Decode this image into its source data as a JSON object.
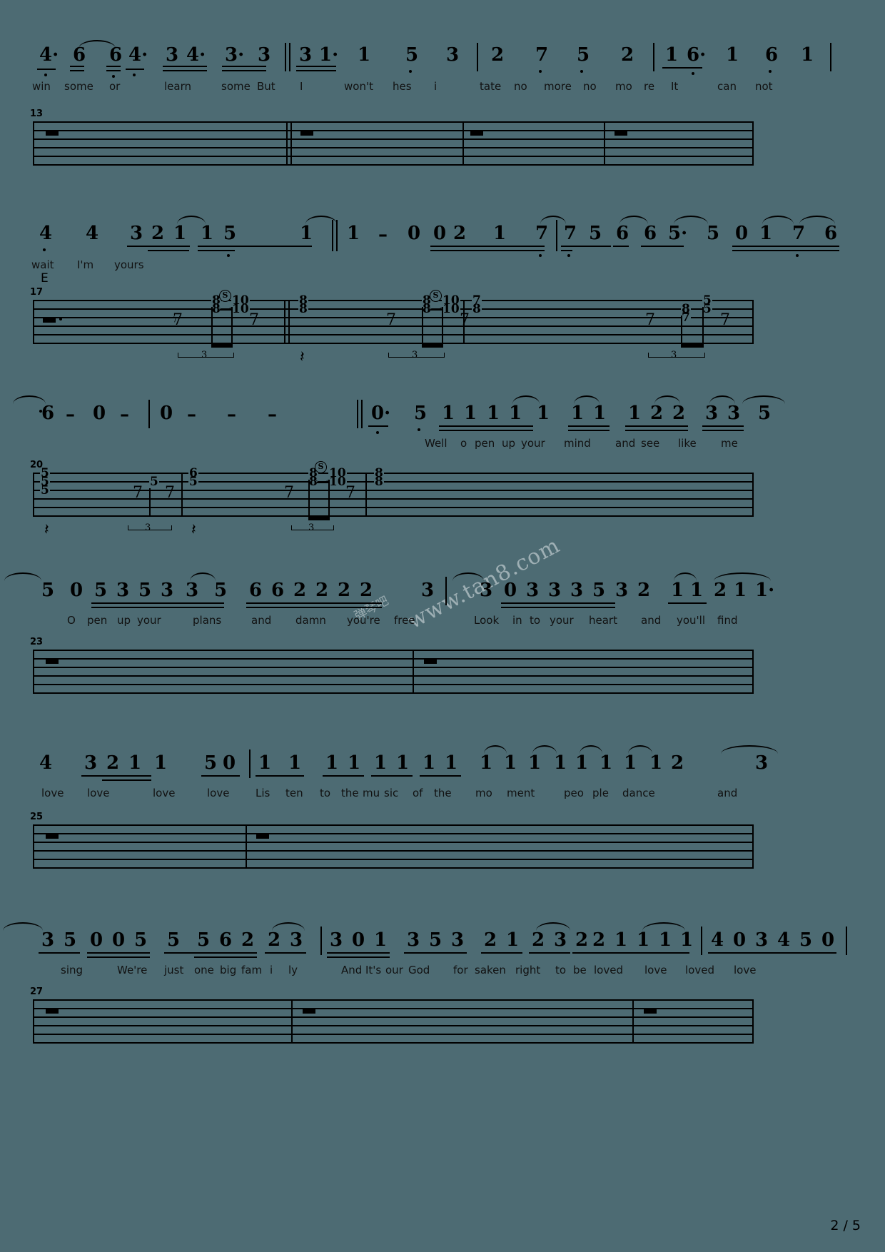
{
  "document": {
    "type": "guitar-tablature-score",
    "page_label": "2 / 5",
    "watermark_text": "www.tan8.com",
    "watermark_cn": "弹琴吧",
    "background_color": "#4d6b73",
    "ink_color": "#000000"
  },
  "systems": [
    {
      "id": "melody-1",
      "kind": "numbered-melody",
      "notes": [
        "4·",
        "6",
        "6",
        "4·",
        "3",
        "4·",
        "3·",
        "3",
        "3",
        "1·",
        "1",
        "5",
        "3",
        "2",
        "7",
        "5",
        "2",
        "1",
        "6·",
        "1",
        "6",
        "1"
      ],
      "lyrics": [
        "win",
        "some",
        "or",
        "learn",
        "some",
        "But",
        "I",
        "won't",
        "hes",
        "i",
        "tate",
        "no",
        "more",
        "no",
        "mo",
        "re",
        "It",
        "can",
        "not"
      ]
    },
    {
      "id": "tab-13",
      "kind": "tab-staff",
      "measure_number": "13",
      "measures": 4,
      "content": "whole-rests"
    },
    {
      "id": "melody-2",
      "kind": "numbered-melody",
      "notes": [
        "4",
        "4",
        "3",
        "2",
        "1",
        "1",
        "5",
        "1",
        "1",
        "-",
        "0",
        "0",
        "2",
        "1",
        "7",
        "7",
        "5",
        "6",
        "6",
        "5·",
        "5",
        "0",
        "1",
        "7",
        "6"
      ],
      "lyrics": [
        "wait",
        "I'm",
        "yours"
      ],
      "chord": "E"
    },
    {
      "id": "tab-17",
      "kind": "tab-staff",
      "measure_number": "17",
      "measures": 4,
      "chord_label": "E",
      "notes": [
        {
          "measure": 1,
          "string": 2,
          "fret": "8",
          "articulation": "slide"
        },
        {
          "measure": 1,
          "string": 3,
          "fret": "8"
        },
        {
          "measure": 1,
          "string": 2,
          "fret": "10"
        },
        {
          "measure": 1,
          "string": 3,
          "fret": "10"
        },
        {
          "measure": 2,
          "string": 2,
          "fret": "8"
        },
        {
          "measure": 2,
          "string": 3,
          "fret": "8"
        },
        {
          "measure": 3,
          "string": 2,
          "fret": "8",
          "articulation": "slide"
        },
        {
          "measure": 3,
          "string": 3,
          "fret": "8"
        },
        {
          "measure": 3,
          "string": 2,
          "fret": "10"
        },
        {
          "measure": 3,
          "string": 3,
          "fret": "10"
        },
        {
          "measure": 4,
          "string": 2,
          "fret": "7"
        },
        {
          "measure": 4,
          "string": 3,
          "fret": "8"
        },
        {
          "measure": 5,
          "string": 2,
          "fret": "5"
        },
        {
          "measure": 5,
          "string": 3,
          "fret": "5"
        },
        {
          "measure": 5,
          "string": 4,
          "fret": "7"
        }
      ],
      "triplets": [
        "3",
        "3",
        "3"
      ]
    },
    {
      "id": "melody-3",
      "kind": "numbered-melody",
      "notes": [
        "6",
        "-",
        "0",
        "-",
        "0",
        "-",
        "-",
        "-",
        "0·",
        "5",
        "1",
        "1",
        "1",
        "1",
        "1",
        "1",
        "1",
        "1",
        "2",
        "2",
        "3",
        "3",
        "5"
      ],
      "lyrics": [
        "Well",
        "o",
        "pen",
        "up",
        "your",
        "mind",
        "and",
        "see",
        "like",
        "me"
      ]
    },
    {
      "id": "tab-20",
      "kind": "tab-staff",
      "measure_number": "20",
      "measures": 4,
      "notes": [
        {
          "measure": 1,
          "string": 2,
          "fret": "5"
        },
        {
          "measure": 1,
          "string": 3,
          "fret": "5"
        },
        {
          "measure": 1,
          "string": 4,
          "fret": "5"
        },
        {
          "measure": 1,
          "string": 3,
          "fret": "5"
        },
        {
          "measure": 2,
          "string": 3,
          "fret": "5"
        },
        {
          "measure": 2,
          "string": 2,
          "fret": "6"
        },
        {
          "measure": 3,
          "string": 2,
          "fret": "8",
          "articulation": "slide"
        },
        {
          "measure": 3,
          "string": 3,
          "fret": "8"
        },
        {
          "measure": 3,
          "string": 2,
          "fret": "10"
        },
        {
          "measure": 3,
          "string": 3,
          "fret": "10"
        },
        {
          "measure": 4,
          "string": 2,
          "fret": "8"
        },
        {
          "measure": 4,
          "string": 3,
          "fret": "8"
        }
      ],
      "triplets": [
        "3",
        "3"
      ]
    },
    {
      "id": "melody-4",
      "kind": "numbered-melody",
      "notes": [
        "5",
        "0",
        "5",
        "3",
        "5",
        "3",
        "3",
        "5",
        "6",
        "6",
        "2",
        "2",
        "2",
        "2",
        "3",
        "3",
        "0",
        "3",
        "3",
        "3",
        "5",
        "3",
        "2",
        "1",
        "1",
        "2",
        "1",
        "1·"
      ],
      "lyrics": [
        "O",
        "pen",
        "up",
        "your",
        "plans",
        "and",
        "damn",
        "you're",
        "free",
        "Look",
        "in",
        "to",
        "your",
        "heart",
        "and",
        "you'll",
        "find"
      ]
    },
    {
      "id": "tab-23",
      "kind": "tab-staff",
      "measure_number": "23",
      "measures": 2,
      "content": "whole-rests"
    },
    {
      "id": "melody-5",
      "kind": "numbered-melody",
      "notes": [
        "4",
        "3",
        "2",
        "1",
        "1",
        "5",
        "0",
        "1",
        "1",
        "1",
        "1",
        "1",
        "1",
        "1",
        "1",
        "1",
        "1",
        "1",
        "1",
        "1",
        "1",
        "1",
        "1",
        "1",
        "2",
        "3"
      ],
      "lyrics": [
        "love",
        "love",
        "love",
        "love",
        "Lis",
        "ten",
        "to",
        "the",
        "mu",
        "sic",
        "of",
        "the",
        "mo",
        "ment",
        "peo",
        "ple",
        "dance",
        "and"
      ]
    },
    {
      "id": "tab-25",
      "kind": "tab-staff",
      "measure_number": "25",
      "measures": 2,
      "content": "whole-rests"
    },
    {
      "id": "melody-6",
      "kind": "numbered-melody",
      "notes": [
        "3",
        "5",
        "0",
        "0",
        "5",
        "5",
        "5",
        "6",
        "2",
        "2",
        "3",
        "3",
        "0",
        "1",
        "3",
        "5",
        "3",
        "2",
        "1",
        "2",
        "3",
        "2",
        "2",
        "1",
        "1",
        "1",
        "1",
        "4",
        "0",
        "3",
        "4",
        "5",
        "0"
      ],
      "lyrics": [
        "sing",
        "We're",
        "just",
        "one",
        "big",
        "fam",
        "i",
        "ly",
        "And",
        "It's",
        "our",
        "God",
        "for",
        "saken",
        "right",
        "to",
        "be",
        "loved",
        "love",
        "loved",
        "love"
      ]
    },
    {
      "id": "tab-27",
      "kind": "tab-staff",
      "measure_number": "27",
      "measures": 3,
      "content": "whole-rests"
    }
  ]
}
